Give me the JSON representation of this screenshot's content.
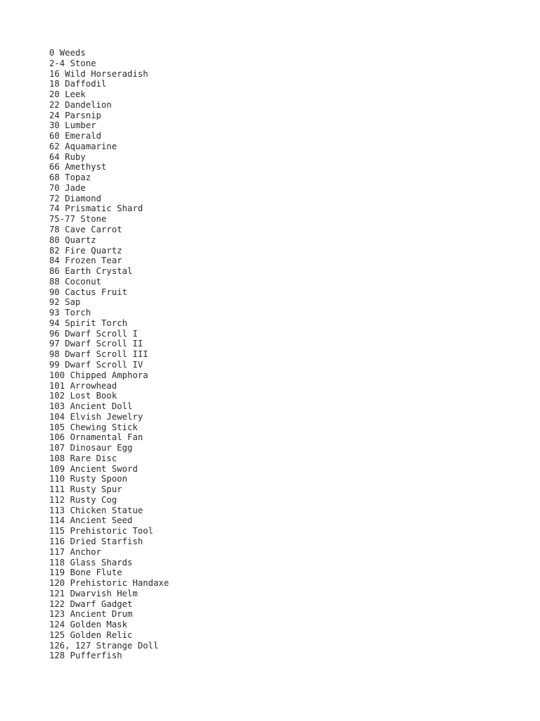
{
  "page": {
    "background_color": "#ffffff",
    "text_color": "#2b2b2b",
    "content_type": "plain-text-item-id-list"
  },
  "item_list": {
    "lines": [
      "0 Weeds",
      "2-4 Stone",
      "16 Wild Horseradish",
      "18 Daffodil",
      "20 Leek",
      "22 Dandelion",
      "24 Parsnip",
      "30 Lumber",
      "60 Emerald",
      "62 Aquamarine",
      "64 Ruby",
      "66 Amethyst",
      "68 Topaz",
      "70 Jade",
      "72 Diamond",
      "74 Prismatic Shard",
      "75-77 Stone",
      "78 Cave Carrot",
      "80 Quartz",
      "82 Fire Quartz",
      "84 Frozen Tear",
      "86 Earth Crystal",
      "88 Coconut",
      "90 Cactus Fruit",
      "92 Sap",
      "93 Torch",
      "94 Spirit Torch",
      "96 Dwarf Scroll I",
      "97 Dwarf Scroll II",
      "98 Dwarf Scroll III",
      "99 Dwarf Scroll IV",
      "100 Chipped Amphora",
      "101 Arrowhead",
      "102 Lost Book",
      "103 Ancient Doll",
      "104 Elvish Jewelry",
      "105 Chewing Stick",
      "106 Ornamental Fan",
      "107 Dinosaur Egg",
      "108 Rare Disc",
      "109 Ancient Sword",
      "110 Rusty Spoon",
      "111 Rusty Spur",
      "112 Rusty Cog",
      "113 Chicken Statue",
      "114 Ancient Seed",
      "115 Prehistoric Tool",
      "116 Dried Starfish",
      "117 Anchor",
      "118 Glass Shards",
      "119 Bone Flute",
      "120 Prehistoric Handaxe",
      "121 Dwarvish Helm",
      "122 Dwarf Gadget",
      "123 Ancient Drum",
      "124 Golden Mask",
      "125 Golden Relic",
      "126, 127 Strange Doll",
      "128 Pufferfish"
    ]
  }
}
